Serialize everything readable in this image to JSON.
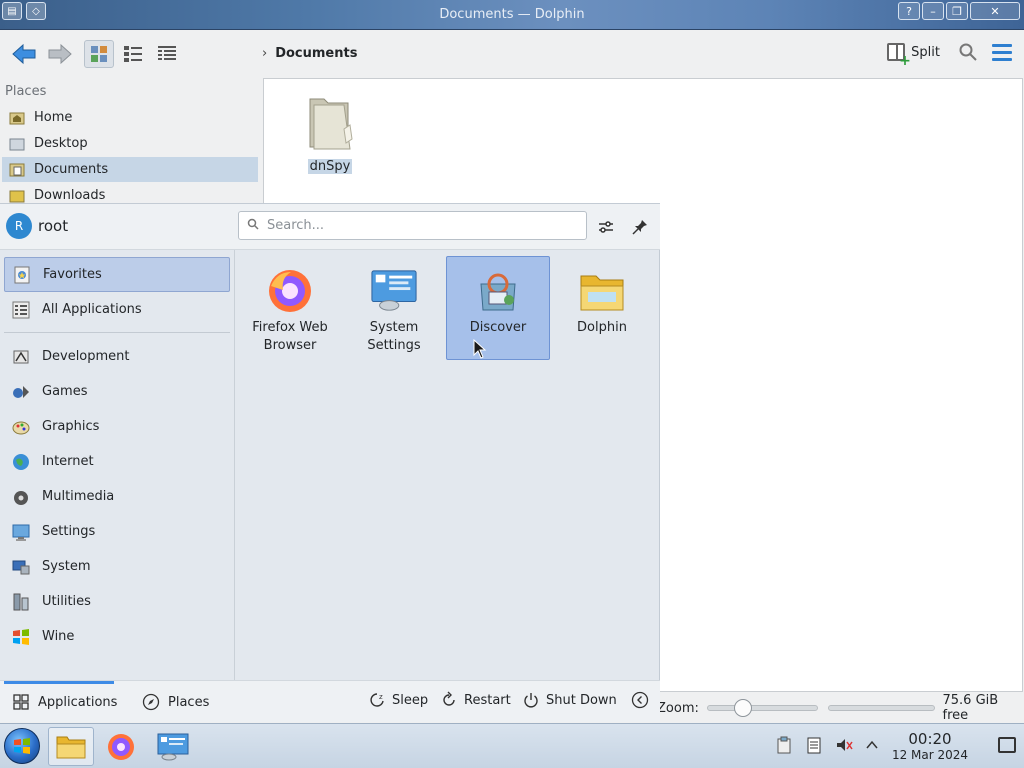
{
  "window": {
    "title": "Documents — Dolphin",
    "help_label": "?",
    "minimize_label": "–",
    "maximize_label": "❐",
    "close_label": "✕"
  },
  "toolbar": {
    "breadcrumb": "Documents",
    "split_label": "Split"
  },
  "places": {
    "heading": "Places",
    "items": [
      {
        "label": "Home",
        "icon": "home-folder-icon"
      },
      {
        "label": "Desktop",
        "icon": "desktop-folder-icon"
      },
      {
        "label": "Documents",
        "icon": "documents-folder-icon",
        "selected": true
      },
      {
        "label": "Downloads",
        "icon": "downloads-folder-icon"
      }
    ]
  },
  "files": [
    {
      "name": "dnSpy",
      "icon": "folder-icon",
      "selected": true
    }
  ],
  "statusbar": {
    "zoom_label": "Zoom:",
    "free_space": "75.6 GiB free"
  },
  "launcher": {
    "user": {
      "initial": "R",
      "name": "root"
    },
    "search_placeholder": "Search...",
    "categories": [
      {
        "label": "Favorites",
        "icon": "favorites-icon",
        "selected": true
      },
      {
        "label": "All Applications",
        "icon": "all-apps-icon"
      },
      {
        "label": "Development",
        "icon": "development-icon"
      },
      {
        "label": "Games",
        "icon": "games-icon"
      },
      {
        "label": "Graphics",
        "icon": "graphics-icon"
      },
      {
        "label": "Internet",
        "icon": "internet-icon"
      },
      {
        "label": "Multimedia",
        "icon": "multimedia-icon"
      },
      {
        "label": "Settings",
        "icon": "settings-icon"
      },
      {
        "label": "System",
        "icon": "system-icon"
      },
      {
        "label": "Utilities",
        "icon": "utilities-icon"
      },
      {
        "label": "Wine",
        "icon": "wine-icon"
      }
    ],
    "favorites": [
      {
        "label": "Firefox Web Browser",
        "icon": "firefox-icon"
      },
      {
        "label": "System Settings",
        "icon": "system-settings-icon"
      },
      {
        "label": "Discover",
        "icon": "discover-icon",
        "selected": true
      },
      {
        "label": "Dolphin",
        "icon": "dolphin-icon"
      }
    ],
    "tabs": [
      {
        "label": "Applications",
        "icon": "grid-icon",
        "active": true
      },
      {
        "label": "Places",
        "icon": "compass-icon"
      }
    ],
    "power": [
      {
        "label": "Sleep",
        "icon": "sleep-icon"
      },
      {
        "label": "Restart",
        "icon": "restart-icon"
      },
      {
        "label": "Shut Down",
        "icon": "power-icon"
      }
    ]
  },
  "taskbar": {
    "time": "00:20",
    "date": "12 Mar 2024"
  }
}
